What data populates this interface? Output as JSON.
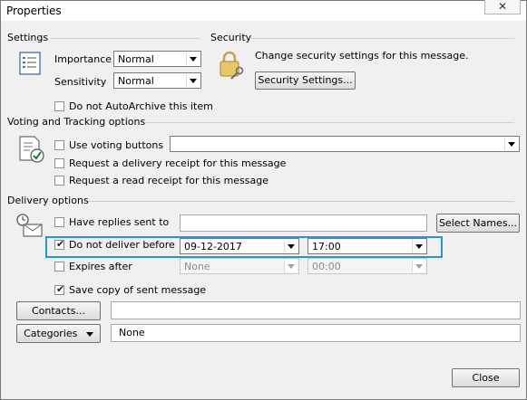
{
  "window": {
    "title": "Properties",
    "close_glyph": "✕"
  },
  "settings": {
    "group_label": "Settings",
    "importance_label": "Importance",
    "importance_value": "Normal",
    "sensitivity_label": "Sensitivity",
    "sensitivity_value": "Normal",
    "no_autoarchive_label": "Do not AutoArchive this item",
    "icon": "settings-list-icon"
  },
  "security": {
    "group_label": "Security",
    "description": "Change security settings for this message.",
    "button_label": "Security Settings...",
    "icon": "lock-key-icon"
  },
  "voting": {
    "group_label": "Voting and Tracking options",
    "use_voting_label": "Use voting buttons",
    "use_voting_value": "",
    "delivery_receipt_label": "Request a delivery receipt for this message",
    "read_receipt_label": "Request a read receipt for this message",
    "icon": "voting-checklist-icon"
  },
  "delivery": {
    "group_label": "Delivery options",
    "replies_label": "Have replies sent to",
    "replies_value": "",
    "select_names_label": "Select Names...",
    "not_before_label": "Do not deliver before",
    "not_before_checked": true,
    "not_before_date": "09-12-2017",
    "not_before_time": "17:00",
    "expires_label": "Expires after",
    "expires_date": "None",
    "expires_time": "00:00",
    "save_copy_label": "Save copy of sent message",
    "save_copy_checked": true,
    "icon": "delivery-clock-icon"
  },
  "contacts": {
    "button_label": "Contacts...",
    "value": ""
  },
  "categories": {
    "button_label": "Categories",
    "value": "None"
  },
  "footer": {
    "close_label": "Close"
  },
  "colors": {
    "highlight": "#1f9ad6",
    "window_bg": "#f0f0f0"
  }
}
